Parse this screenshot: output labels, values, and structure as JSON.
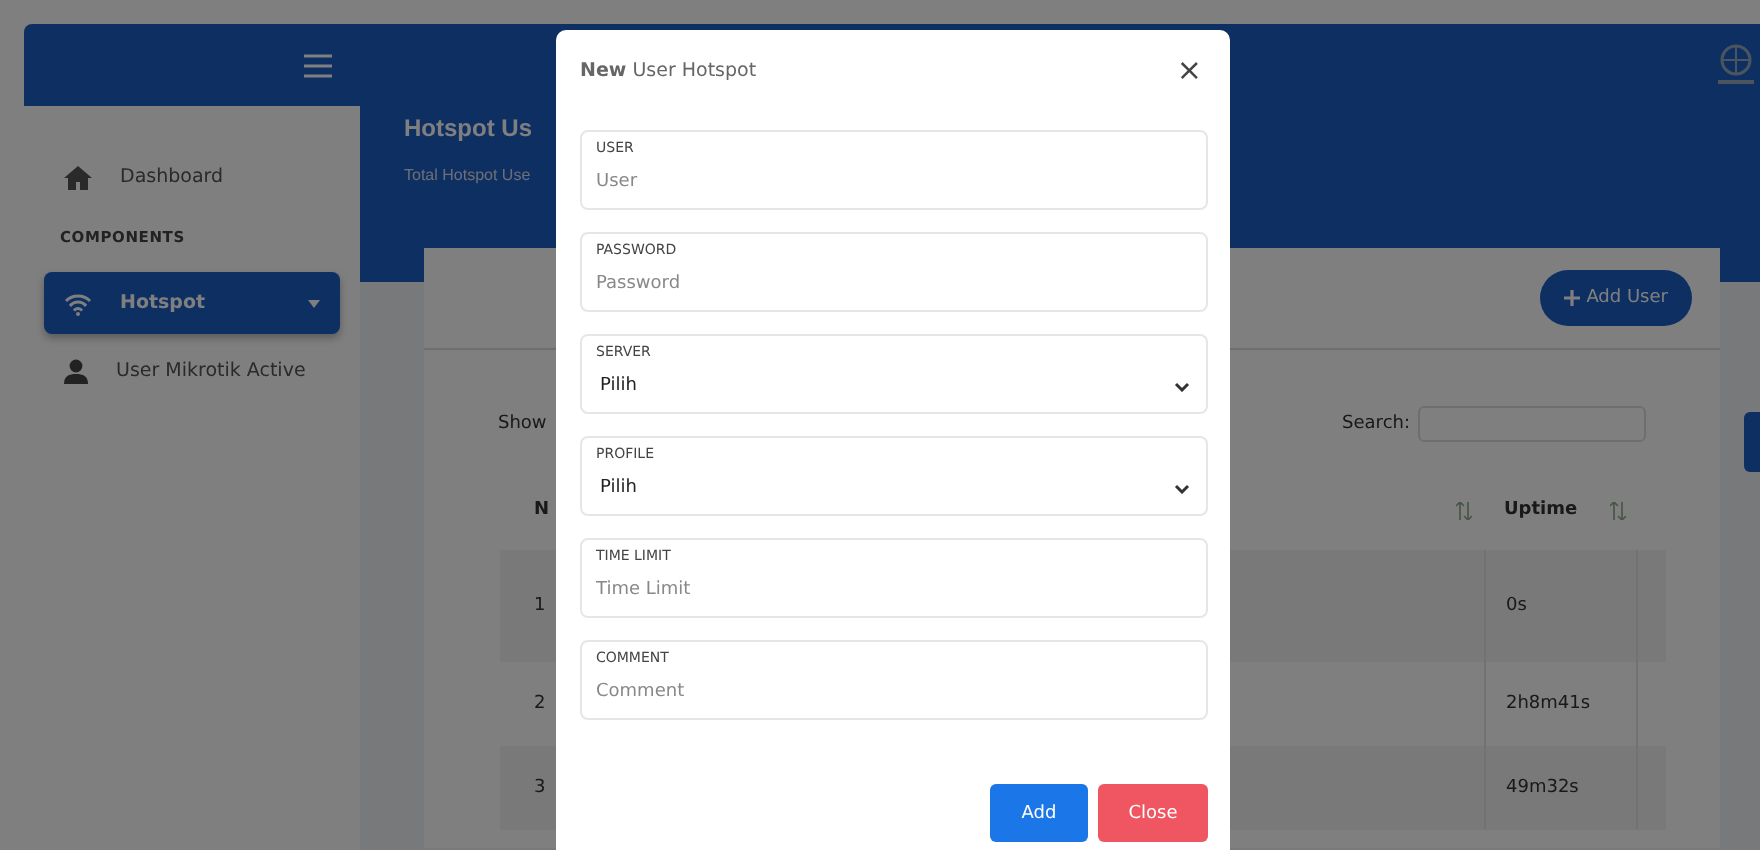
{
  "sidebar": {
    "items": [
      {
        "kind": "link",
        "label": "Dashboard",
        "selected": false,
        "caret": false
      },
      {
        "kind": "heading",
        "label": "COMPONENTS"
      },
      {
        "kind": "link",
        "label": "Hotspot",
        "selected": true,
        "caret": true
      },
      {
        "kind": "link",
        "label": "User Mikrotik Active",
        "selected": false,
        "caret": false
      }
    ]
  },
  "page": {
    "title": "Hotspot Us",
    "subtitle": "Total Hotspot Use"
  },
  "card": {
    "add_button": "Add User",
    "show_label": "Show",
    "search_label": "Search:",
    "table": {
      "columns": [
        "N",
        "Uptime"
      ],
      "rows": [
        {
          "number": "1",
          "uptime": "0s"
        },
        {
          "number": "2",
          "uptime": "2h8m41s"
        },
        {
          "number": "3",
          "uptime": "49m32s"
        }
      ]
    }
  },
  "modal": {
    "title": "**New** User Hotspot",
    "close": "×",
    "fields": [
      {
        "kind": "text",
        "label": "USER",
        "placeholder": "User"
      },
      {
        "kind": "text",
        "label": "PASSWORD",
        "placeholder": "Password"
      },
      {
        "kind": "select",
        "label": "SERVER",
        "value": "Pilih"
      },
      {
        "kind": "select",
        "label": "PROFILE",
        "value": "Pilih"
      },
      {
        "kind": "text",
        "label": "TIME LIMIT",
        "placeholder": "Time Limit"
      },
      {
        "kind": "text",
        "label": "COMMENT",
        "placeholder": "Comment"
      }
    ],
    "buttons": [
      {
        "kind": "primary",
        "label": "Add"
      },
      {
        "kind": "danger",
        "label": "Close"
      }
    ]
  }
}
